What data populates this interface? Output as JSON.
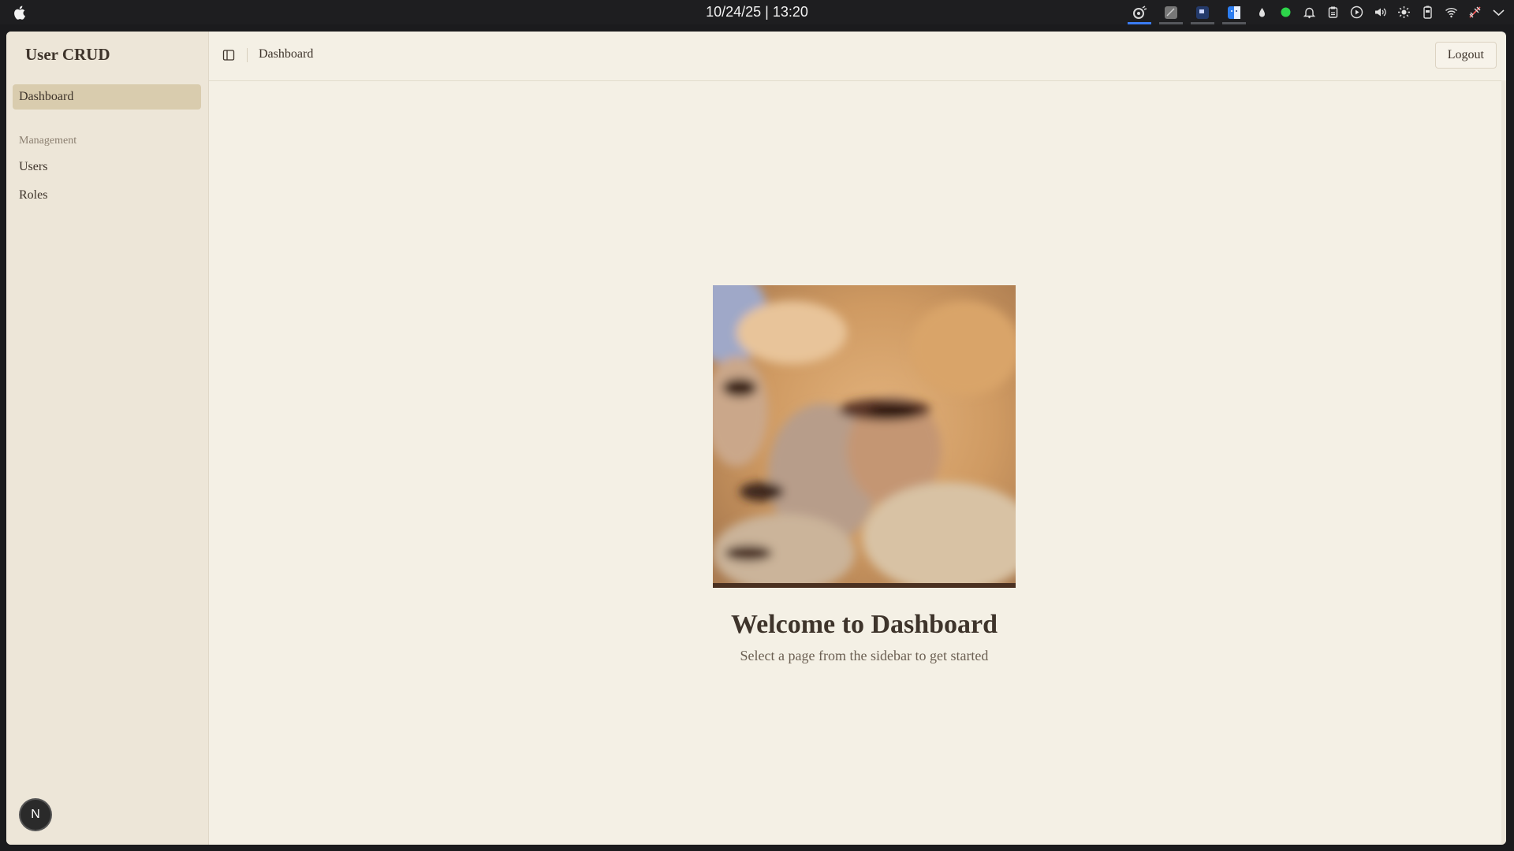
{
  "menubar": {
    "clock": "10/24/25 | 13:20"
  },
  "app": {
    "brand": "User CRUD",
    "colors": {
      "sidebar_bg": "#ede6d8",
      "main_bg": "#f4f0e5",
      "active_item_bg": "#d9ccae",
      "text": "#3e342b"
    }
  },
  "sidebar": {
    "items": [
      {
        "label": "Dashboard",
        "active": true
      }
    ],
    "section_label": "Management",
    "management_items": [
      {
        "label": "Users"
      },
      {
        "label": "Roles"
      }
    ],
    "avatar_letter": "N"
  },
  "header": {
    "breadcrumb": "Dashboard",
    "logout_label": "Logout"
  },
  "main": {
    "title": "Welcome to Dashboard",
    "subtitle": "Select a page from the sidebar to get started"
  }
}
